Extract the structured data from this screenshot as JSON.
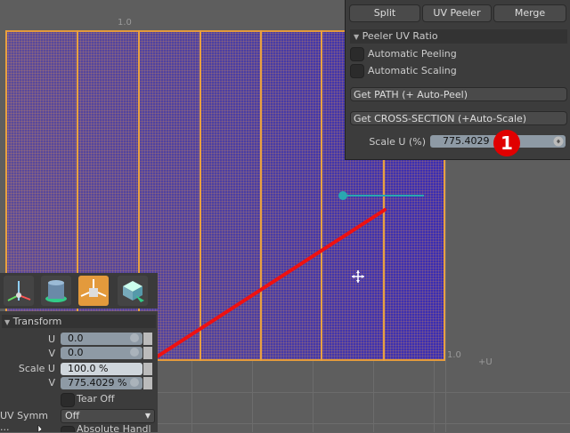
{
  "viewport": {
    "top_axis_label": "1.0",
    "right_axis_label": "1.0",
    "u_axis_label": "+U"
  },
  "peeler_panel": {
    "buttons": {
      "split": "Split",
      "uv_peeler": "UV Peeler",
      "merge": "Merge"
    },
    "section_title": "Peeler UV Ratio",
    "automatic_peeling": {
      "label": "Automatic Peeling",
      "checked": false
    },
    "automatic_scaling": {
      "label": "Automatic Scaling",
      "checked": false
    },
    "get_path": "Get PATH (+ Auto-Peel)",
    "get_cross_section": "Get CROSS-SECTION (+Auto-Scale)",
    "scale_u_label": "Scale U (%)",
    "scale_u_value": "775.4029"
  },
  "annotation": {
    "badge_number": "1",
    "color": "#e00000"
  },
  "transform_panel": {
    "title": "Transform",
    "u_label": "U",
    "u_value": "0.0",
    "v_label": "V",
    "v_value": "0.0",
    "scale_u_label": "Scale U",
    "scale_u_value": "100.0 %",
    "scale_v_label": "V",
    "scale_v_value": "775.4029 %",
    "tear_off_label": "Tear Off",
    "uv_symm_label": "UV Symm ...",
    "uv_symm_value": "Off",
    "absolute_label": "Absolute Handl"
  },
  "tools": [
    "transform-axis-icon",
    "cylinder-icon",
    "move-handle-icon",
    "cube-arrow-icon"
  ]
}
